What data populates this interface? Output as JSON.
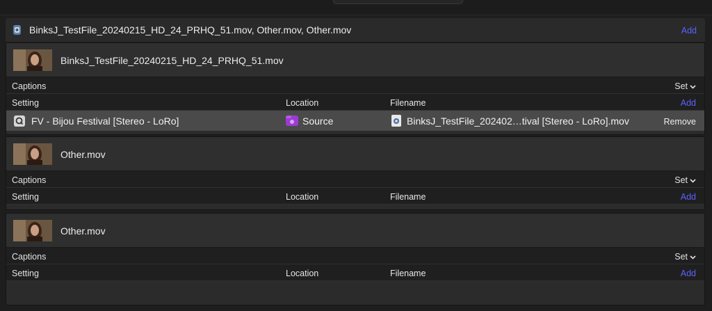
{
  "job": {
    "title": "BinksJ_TestFile_20240215_HD_24_PRHQ_51.mov, Other.mov, Other.mov",
    "add_label": "Add"
  },
  "clips": [
    {
      "name": "BinksJ_TestFile_20240215_HD_24_PRHQ_51.mov",
      "captions_label": "Captions",
      "set_label": "Set",
      "col_setting": "Setting",
      "col_location": "Location",
      "col_filename": "Filename",
      "add_label": "Add",
      "output": {
        "setting": "FV - Bijou Festival [Stereo - LoRo]",
        "location": "Source",
        "filename": "BinksJ_TestFile_202402…tival [Stereo - LoRo].mov",
        "remove_label": "Remove"
      }
    },
    {
      "name": "Other.mov",
      "captions_label": "Captions",
      "set_label": "Set",
      "col_setting": "Setting",
      "col_location": "Location",
      "col_filename": "Filename",
      "add_label": "Add"
    },
    {
      "name": "Other.mov",
      "captions_label": "Captions",
      "set_label": "Set",
      "col_setting": "Setting",
      "col_location": "Location",
      "col_filename": "Filename",
      "add_label": "Add"
    }
  ],
  "colors": {
    "accent_link": "#5a63ff",
    "selected_row": "#4a4a4a",
    "source_icon": "#9b3bd6"
  },
  "icons": {
    "job": "compressor-job-icon",
    "setting": "quicktime-icon",
    "location": "source-folder-icon",
    "filename": "movie-file-icon",
    "set_menu": "chevron-down-icon"
  }
}
